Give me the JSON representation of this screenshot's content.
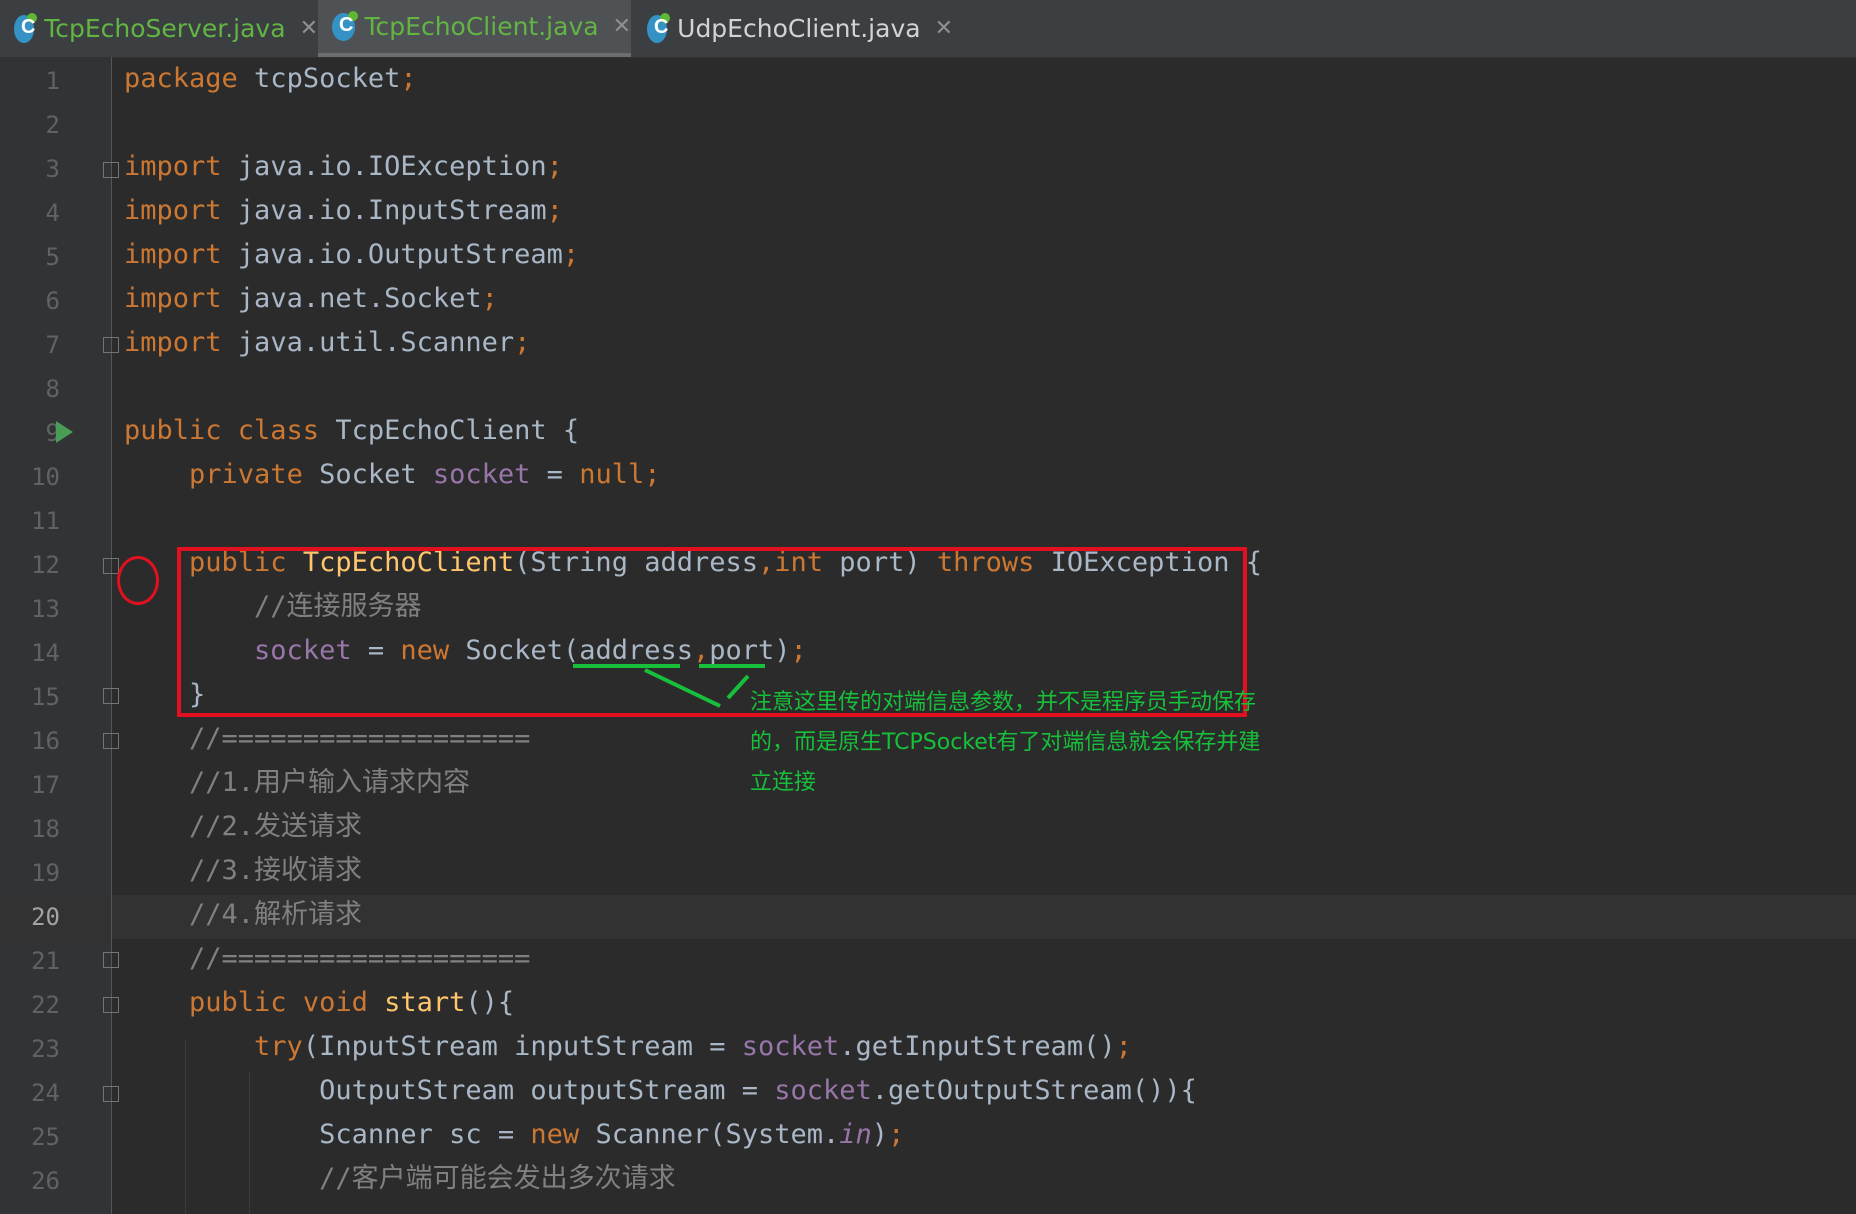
{
  "tabs": [
    {
      "label": "TcpEchoServer.java",
      "state": "inactive",
      "color": "#62b543"
    },
    {
      "label": "TcpEchoClient.java",
      "state": "active",
      "color": "#62b543"
    },
    {
      "label": "UdpEchoClient.java",
      "state": "inactive",
      "color": "#d3d3d3"
    }
  ],
  "editor": {
    "current_line": 20,
    "line_numbers": [
      "1",
      "2",
      "3",
      "4",
      "5",
      "6",
      "7",
      "8",
      "9",
      "10",
      "11",
      "12",
      "13",
      "14",
      "15",
      "16",
      "17",
      "18",
      "19",
      "20",
      "21",
      "22",
      "23",
      "24",
      "25",
      "26"
    ]
  },
  "code": {
    "l1": {
      "kw": "package",
      "rest": " tcpSocket",
      "semi": ";"
    },
    "l3": {
      "kw": "import",
      "rest": " java.io.IOException",
      "semi": ";"
    },
    "l4": {
      "kw": "import",
      "rest": " java.io.InputStream",
      "semi": ";"
    },
    "l5": {
      "kw": "import",
      "rest": " java.io.OutputStream",
      "semi": ";"
    },
    "l6": {
      "kw": "import",
      "rest": " java.net.Socket",
      "semi": ";"
    },
    "l7": {
      "kw": "import",
      "rest": " java.util.Scanner",
      "semi": ";"
    },
    "l9": {
      "kw": "public class",
      "rest": " TcpEchoClient {"
    },
    "l10": {
      "kw": "private",
      "type": " Socket ",
      "field": "socket",
      "eq": " = ",
      "null": "null",
      "semi": ";"
    },
    "l12": {
      "kw1": "public ",
      "fn": "TcpEchoClient",
      "p1": "(String address",
      "comma": ",",
      "kw2": "int",
      "p2": " port) ",
      "kw3": "throws",
      "p3": " IOException {"
    },
    "l13": "//连接服务器",
    "l14": {
      "field": "socket",
      "eq": " = ",
      "kw": "new",
      "p1": " Socket(address",
      "comma": ",",
      "p2": "port)",
      "semi": ";"
    },
    "l15": "}",
    "l16": "//===================",
    "l17": "//1.用户输入请求内容",
    "l18": "//2.发送请求",
    "l19": "//3.接收请求",
    "l20": "//4.解析请求",
    "l21": "//===================",
    "l22": {
      "kw": "public void",
      "fn": " start",
      "rest": "(){"
    },
    "l23": {
      "kw": "try",
      "p1": "(InputStream inputStream = ",
      "field": "socket",
      "p2": ".getInputStream()",
      "semi": ";"
    },
    "l24": {
      "p1": "OutputStream outputStream = ",
      "field": "socket",
      "p2": ".getOutputStream()){"
    },
    "l25": {
      "p1": "Scanner sc = ",
      "kw": "new",
      "p2": " Scanner(System.",
      "it": "in",
      "p3": ")",
      "semi": ";"
    },
    "l26": "//客户端可能会发出多次请求"
  },
  "annotation": {
    "note": "注意这里传的对端信息参数，并不是程序员手动保存的，而是原生TCPSocket有了对端信息就会保存并建立连接",
    "highlight_color": "#e3101f",
    "note_color": "#17c03a"
  }
}
